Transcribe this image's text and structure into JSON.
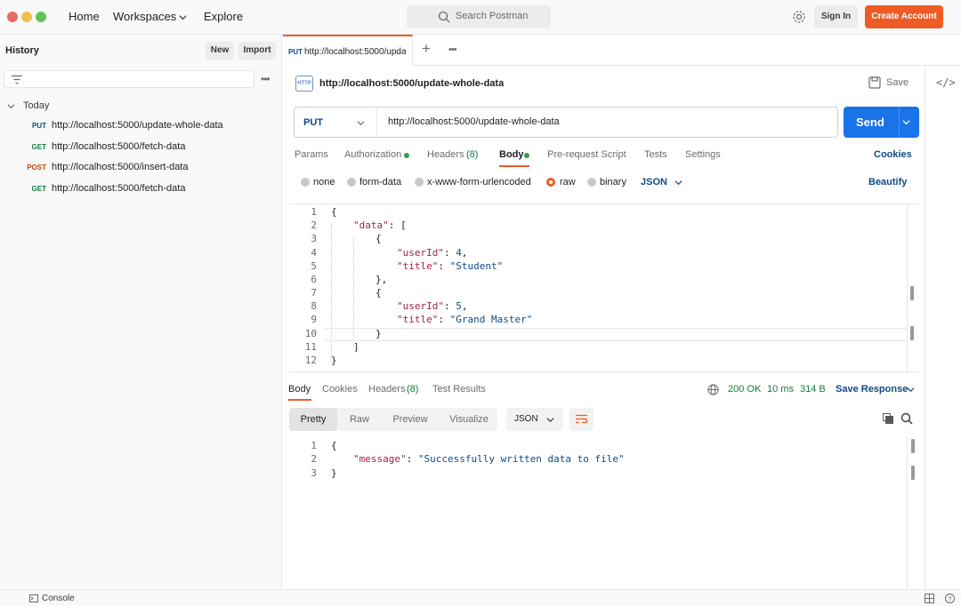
{
  "topbar": {
    "nav": [
      "Home",
      "Workspaces",
      "Explore"
    ],
    "search_placeholder": "Search Postman",
    "sign_in": "Sign In",
    "create_account": "Create Account"
  },
  "sidebar": {
    "title": "History",
    "new_label": "New",
    "import_label": "Import",
    "group_label": "Today",
    "items": [
      {
        "method": "PUT",
        "url": "http://localhost:5000/update-whole-data",
        "color": "#0e4b86"
      },
      {
        "method": "GET",
        "url": "http://localhost:5000/fetch-data",
        "color": "#0f7b3e"
      },
      {
        "method": "POST",
        "url": "http://localhost:5000/insert-data",
        "color": "#c14a13"
      },
      {
        "method": "GET",
        "url": "http://localhost:5000/fetch-data",
        "color": "#0f7b3e"
      }
    ]
  },
  "tab": {
    "method": "PUT",
    "label": "http://localhost:5000/upda"
  },
  "request": {
    "title": "http://localhost:5000/update-whole-data",
    "save_label": "Save",
    "method": "PUT",
    "url": "http://localhost:5000/update-whole-data",
    "send_label": "Send",
    "tabs": {
      "params": "Params",
      "authorization": "Authorization",
      "headers": "Headers",
      "headers_count": "(8)",
      "body": "Body",
      "prerequest": "Pre-request Script",
      "tests": "Tests",
      "settings": "Settings",
      "cookies": "Cookies"
    },
    "body_types": {
      "none": "none",
      "form_data": "form-data",
      "urlencoded": "x-www-form-urlencoded",
      "raw": "raw",
      "binary": "binary",
      "format": "JSON",
      "beautify": "Beautify"
    },
    "line_numbers": [
      "1",
      "2",
      "3",
      "4",
      "5",
      "6",
      "7",
      "8",
      "9",
      "10",
      "11",
      "12"
    ],
    "code": {
      "l1": "{",
      "l2_key": "\"data\"",
      "l2_rest": ": [",
      "l3": "{",
      "l4_key": "\"userId\"",
      "l4_sep": ": ",
      "l4_val": "4",
      "l4_end": ",",
      "l5_key": "\"title\"",
      "l5_sep": ": ",
      "l5_val": "\"Student\"",
      "l6": "},",
      "l7": "{",
      "l8_key": "\"userId\"",
      "l8_sep": ": ",
      "l8_val": "5",
      "l8_end": ",",
      "l9_key": "\"title\"",
      "l9_sep": ": ",
      "l9_val": "\"Grand Master\"",
      "l10": "}",
      "l11": "]",
      "l12": "}"
    }
  },
  "response": {
    "tabs": {
      "body": "Body",
      "cookies": "Cookies",
      "headers": "Headers",
      "headers_count": "(8)",
      "test_results": "Test Results"
    },
    "status": "200 OK",
    "time": "10 ms",
    "size": "314 B",
    "save_response": "Save Response",
    "views": [
      "Pretty",
      "Raw",
      "Preview",
      "Visualize"
    ],
    "format": "JSON",
    "line_numbers": [
      "1",
      "2",
      "3"
    ],
    "code": {
      "l1": "{",
      "l2_key": "\"message\"",
      "l2_sep": ": ",
      "l2_val": "\"Successfully written data to file\"",
      "l3": "}"
    }
  },
  "bottombar": {
    "console": "Console"
  },
  "colors": {
    "accent": "#ef5b25",
    "send": "#1a73e8",
    "status_ok": "#0f7b3e",
    "dot_green": "#2e9e4f"
  }
}
